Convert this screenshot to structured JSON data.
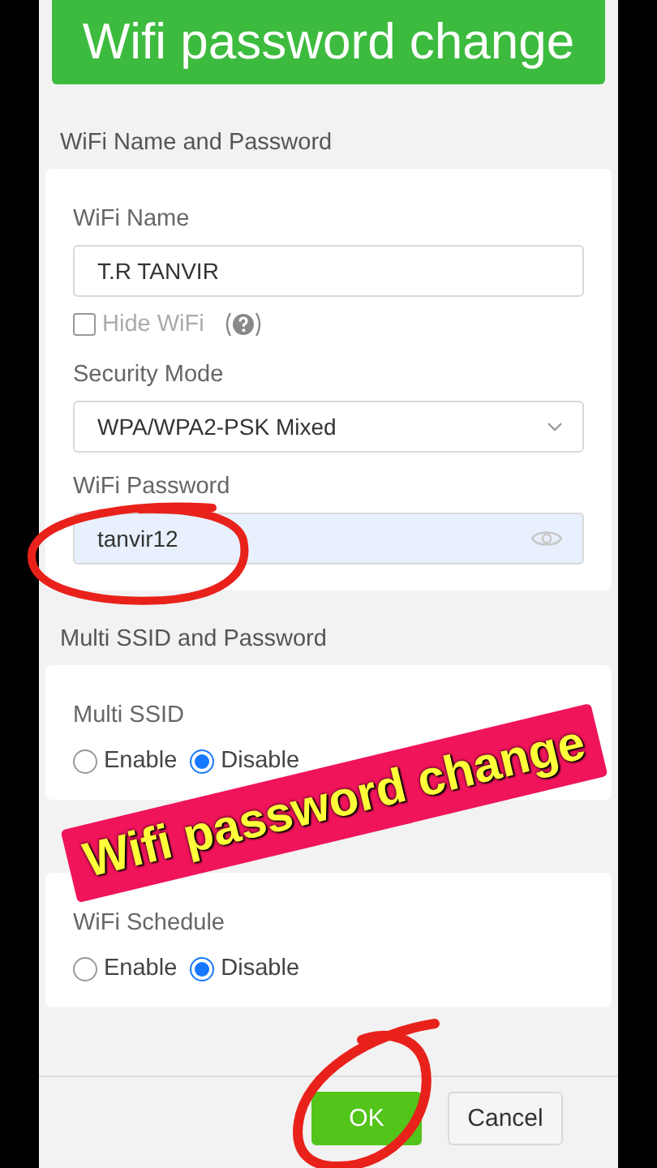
{
  "banner": {
    "title": "Wifi password change"
  },
  "sections": [
    {
      "title": "WiFi Name and Password",
      "items": [
        {
          "kind": "text",
          "label": "WiFi Name",
          "value": "T.R TANVIR"
        },
        {
          "kind": "checkbox",
          "label": "Hide WiFi",
          "checked": false
        },
        {
          "kind": "select",
          "label": "Security Mode",
          "value": "WPA/WPA2-PSK Mixed"
        },
        {
          "kind": "password",
          "label": "WiFi Password",
          "value": "tanvir12"
        }
      ]
    },
    {
      "title": "Multi SSID and Password",
      "items": [
        {
          "kind": "radio",
          "label": "Multi SSID",
          "options": [
            {
              "label": "Enable",
              "selected": false
            },
            {
              "label": "Disable",
              "selected": true
            }
          ]
        }
      ]
    },
    {
      "items": [
        {
          "kind": "radio",
          "label": "WiFi Schedule",
          "options": [
            {
              "label": "Enable",
              "selected": false
            },
            {
              "label": "Disable",
              "selected": true
            }
          ]
        }
      ]
    }
  ],
  "buttons": [
    {
      "label": "OK",
      "kind": "primary"
    },
    {
      "label": "Cancel",
      "kind": "default"
    }
  ],
  "sticker": {
    "text": "Wifi password change"
  }
}
